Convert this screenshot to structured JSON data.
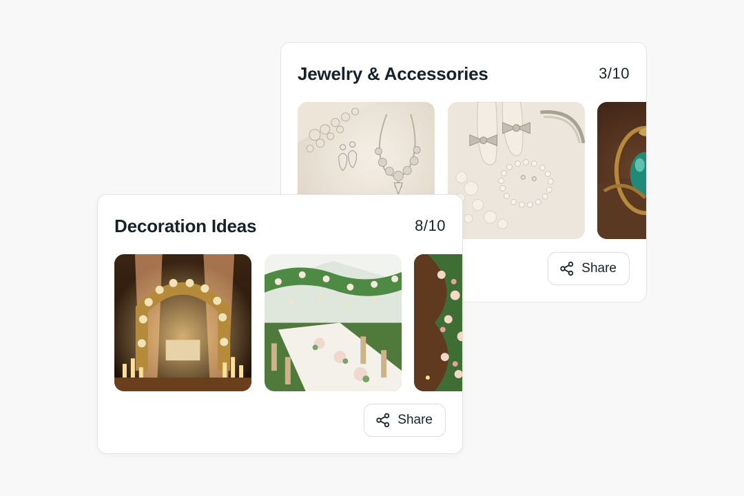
{
  "boards": [
    {
      "title": "Jewelry & Accessories",
      "counter": "3/10",
      "share_label": "Share",
      "images": [
        {
          "icon": "bridal-jewelry-set-image"
        },
        {
          "icon": "bridal-shoes-pearls-image"
        },
        {
          "icon": "emerald-ring-image"
        }
      ]
    },
    {
      "title": "Decoration Ideas",
      "counter": "8/10",
      "share_label": "Share",
      "images": [
        {
          "icon": "floral-arch-candles-image"
        },
        {
          "icon": "tent-banquet-table-image"
        },
        {
          "icon": "floral-column-image"
        }
      ]
    }
  ],
  "colors": {
    "background": "#f8f8f8",
    "card": "#ffffff",
    "text": "#16222a",
    "border": "#e2e4e6"
  }
}
